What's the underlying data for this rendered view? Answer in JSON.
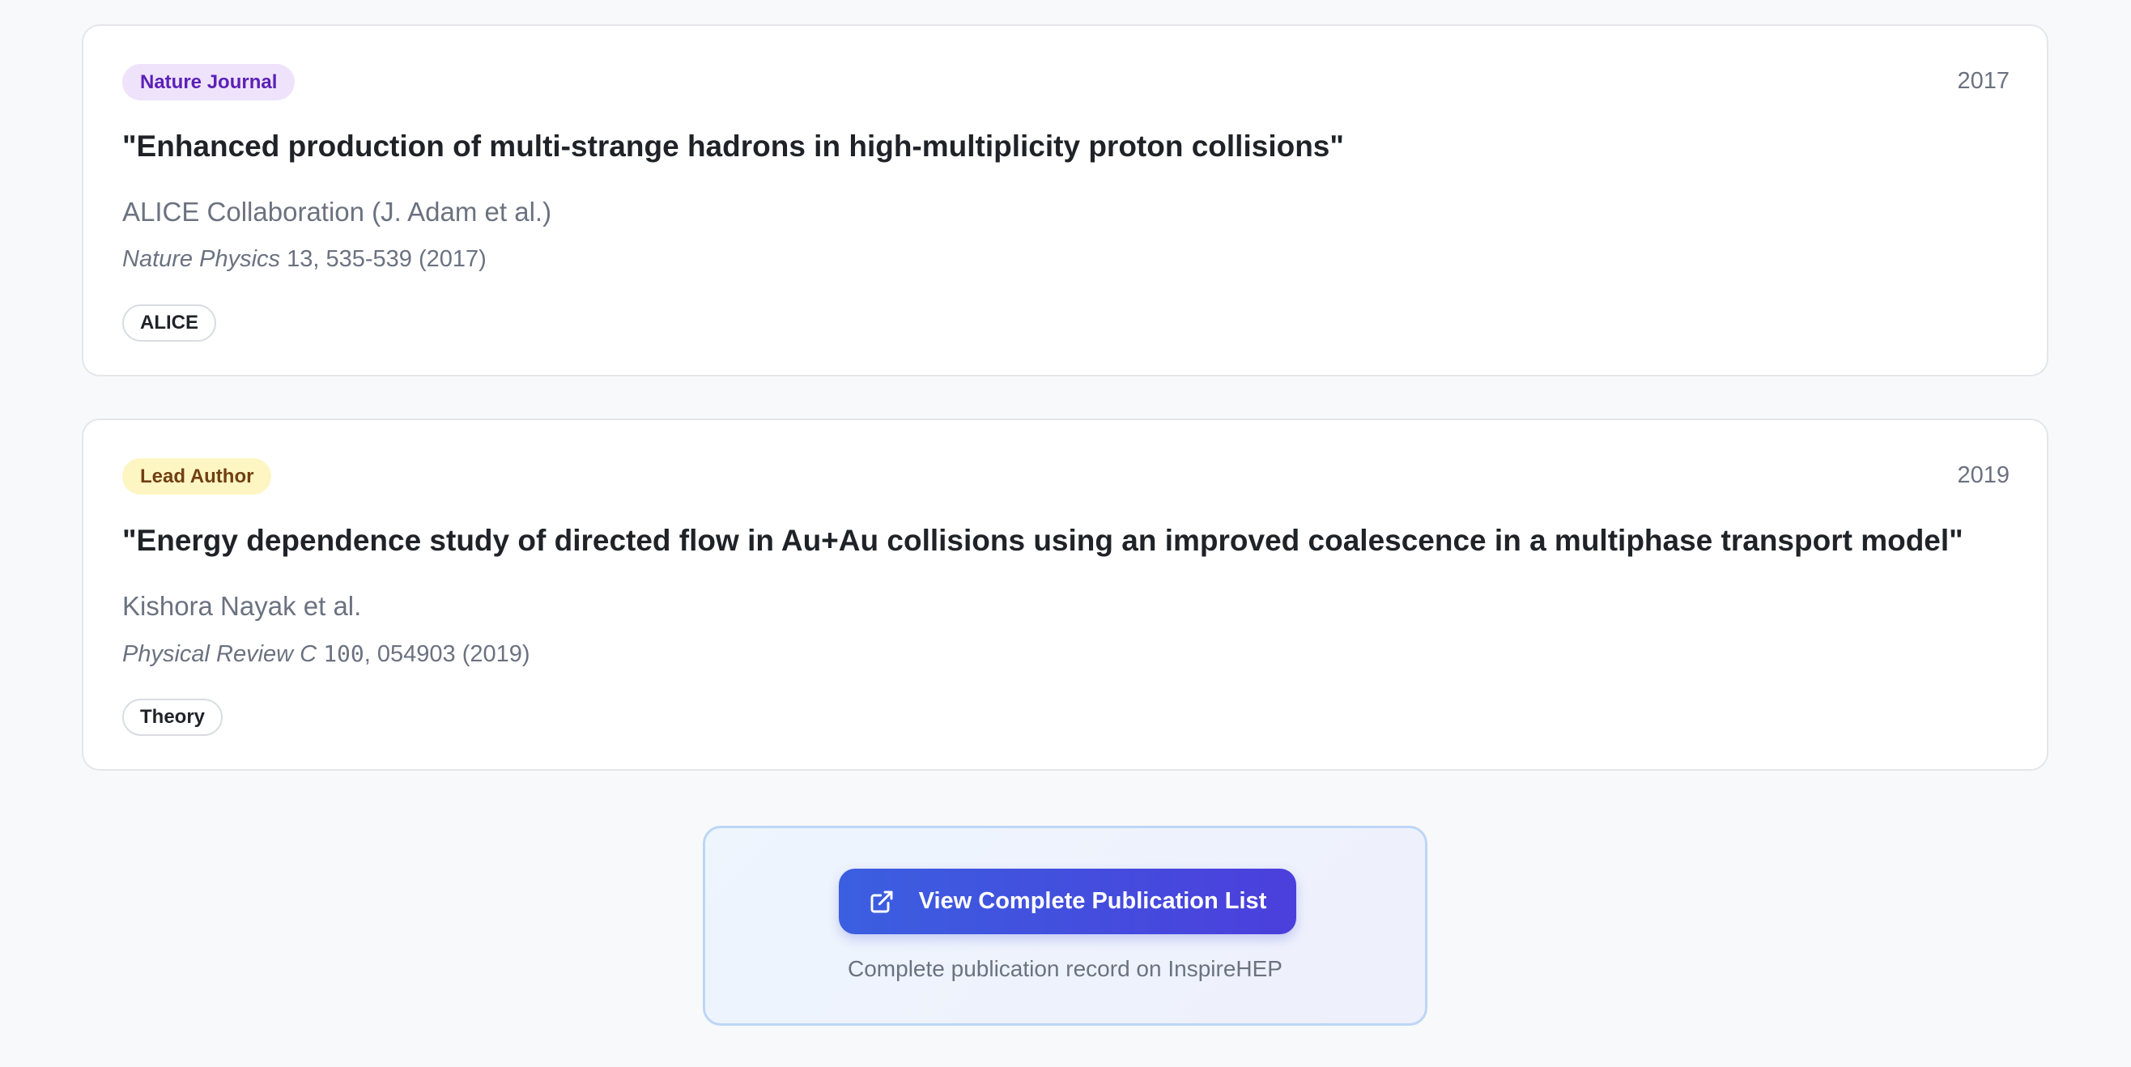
{
  "publications": [
    {
      "badge": "Nature Journal",
      "year": "2017",
      "title": "\"Enhanced production of multi-strange hadrons in high-multiplicity proton collisions\"",
      "authors": "ALICE Collaboration (J. Adam et al.)",
      "journal_name": "Nature Physics",
      "journal_volume": "13",
      "journal_rest": ", 535-539 (2017)",
      "tag": "ALICE"
    },
    {
      "badge": "Lead Author",
      "year": "2019",
      "title": "\"Energy dependence study of directed flow in Au+Au collisions using an improved coalescence in a multiphase transport model\"",
      "authors": "Kishora Nayak et al.",
      "journal_name": "Physical Review C",
      "journal_volume": "100",
      "journal_rest": ", 054903 (2019)",
      "tag": "Theory"
    }
  ],
  "cta": {
    "button_label": "View Complete Publication List",
    "button_icon": "external-link-icon",
    "caption": "Complete publication record on InspireHEP"
  },
  "colors": {
    "badge_nature_bg": "#efe3fb",
    "badge_nature_text": "#5b21b6",
    "badge_lead_bg": "#fdf6c3",
    "badge_lead_text": "#713f12",
    "button_gradient_start": "#3b5fe0",
    "button_gradient_end": "#4b3fdc"
  }
}
